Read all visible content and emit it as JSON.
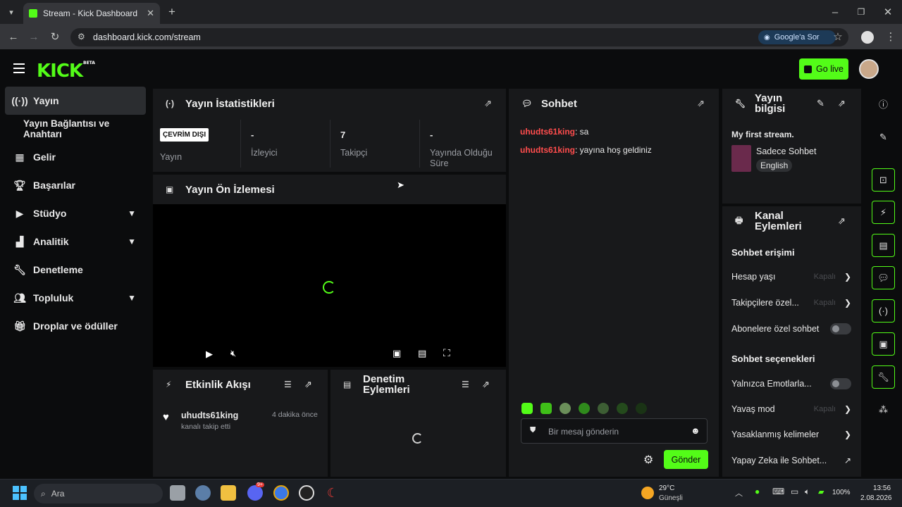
{
  "browser": {
    "tab_title": "Stream - Kick Dashboard",
    "url": "dashboard.kick.com/stream",
    "ask_google": "Google'a Sor"
  },
  "header": {
    "logo": "KICK",
    "logo_badge": "BETA",
    "go_live": "Go live"
  },
  "sidebar": {
    "items": [
      {
        "label": "Yayın",
        "icon": "broadcast-icon",
        "active": true
      },
      {
        "label": "Yayın Bağlantısı ve Anahtarı",
        "icon": "",
        "active": false
      },
      {
        "label": "Gelir",
        "icon": "chart-icon"
      },
      {
        "label": "Başarılar",
        "icon": "trophy-icon"
      },
      {
        "label": "Stüdyo",
        "icon": "video-icon",
        "expandable": true
      },
      {
        "label": "Analitik",
        "icon": "analytics-icon",
        "expandable": true
      },
      {
        "label": "Denetleme",
        "icon": "wrench-icon"
      },
      {
        "label": "Topluluk",
        "icon": "users-icon",
        "expandable": true
      },
      {
        "label": "Droplar ve ödüller",
        "icon": "gift-icon"
      }
    ]
  },
  "stats": {
    "title": "Yayın İstatistikleri",
    "status_badge": "ÇEVRİM DIŞI",
    "status_label": "Yayın",
    "viewers_value": "-",
    "viewers_label": "İzleyici",
    "followers_value": "7",
    "followers_label": "Takipçi",
    "duration_value": "-",
    "duration_label": "Yayında Olduğu Süre"
  },
  "preview": {
    "title": "Yayın Ön İzlemesi"
  },
  "activity": {
    "title": "Etkinlik Akışı",
    "event_user": "uhudts61king",
    "event_text": "kanalı takip etti",
    "event_time": "4 dakika önce"
  },
  "moderation": {
    "title": "Denetim Eylemleri"
  },
  "chat": {
    "title": "Sohbet",
    "messages": [
      {
        "user": "uhudts61king",
        "text": ": sa"
      },
      {
        "user": "uhudts61king",
        "text": ": yayına hoş geldiniz"
      }
    ],
    "placeholder": "Bir mesaj gönderin",
    "send": "Gönder"
  },
  "stream_info": {
    "title": "Yayın bilgisi",
    "stream_title": "My first stream.",
    "category": "Sadece Sohbet",
    "language": "English"
  },
  "channel_actions": {
    "title": "Kanal Eylemleri",
    "chat_access": "Sohbet erişimi",
    "account_age": "Hesap yaşı",
    "followers_only": "Takipçilere özel...",
    "subs_only": "Abonelere özel sohbet",
    "off": "Kapalı",
    "chat_options": "Sohbet seçenekleri",
    "emotes_only": "Yalnızca Emotlarla...",
    "slow_mode": "Yavaş mod",
    "banned_words": "Yasaklanmış kelimeler",
    "ai_chat": "Yapay Zeka ile Sohbet..."
  },
  "taskbar": {
    "search": "Ara",
    "weather_temp": "29°C",
    "weather_desc": "Güneşli",
    "battery": "100%",
    "time": "13:56",
    "date": "2.08.2026",
    "discord_badge": "9+"
  },
  "colors": {
    "accent": "#53fc18",
    "chat_user": "#ff4d4d"
  }
}
